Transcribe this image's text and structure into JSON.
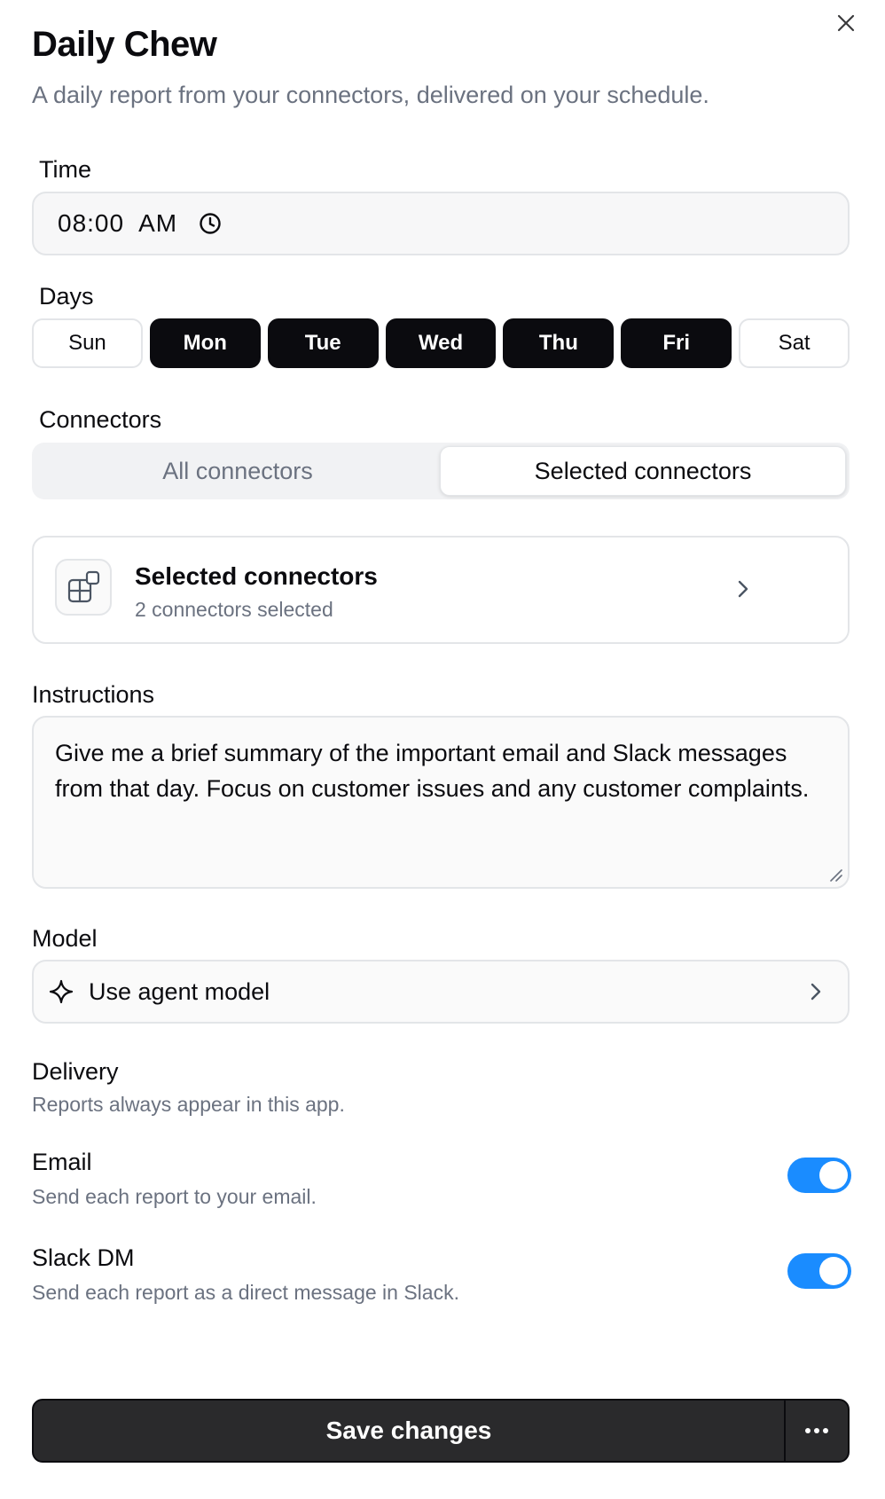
{
  "header": {
    "title": "Daily Chew",
    "subtitle": "A daily report from your connectors, delivered on your schedule."
  },
  "time": {
    "label": "Time",
    "value": "08:00  AM"
  },
  "days": {
    "label": "Days",
    "items": [
      {
        "label": "Sun",
        "active": false
      },
      {
        "label": "Mon",
        "active": true
      },
      {
        "label": "Tue",
        "active": true
      },
      {
        "label": "Wed",
        "active": true
      },
      {
        "label": "Thu",
        "active": true
      },
      {
        "label": "Fri",
        "active": true
      },
      {
        "label": "Sat",
        "active": false
      }
    ]
  },
  "connectors": {
    "label": "Connectors",
    "tabs": [
      {
        "label": "All connectors",
        "active": false
      },
      {
        "label": "Selected connectors",
        "active": true
      }
    ],
    "card_title": "Selected connectors",
    "card_subtitle": "2 connectors selected"
  },
  "instructions": {
    "label": "Instructions",
    "value": "Give me a brief summary of the important email and Slack messages from that day. Focus on customer issues and any customer complaints."
  },
  "model": {
    "label": "Model",
    "value": "Use agent model"
  },
  "delivery": {
    "label": "Delivery",
    "note": "Reports always appear in this app.",
    "email_label": "Email",
    "email_desc": "Send each report to your email.",
    "email_on": true,
    "slack_label": "Slack DM",
    "slack_desc": "Send each report as a direct message in Slack.",
    "slack_on": true
  },
  "footer": {
    "save_label": "Save changes"
  },
  "colors": {
    "accent": "#1a8cff",
    "selected_day": "#0b0b0f",
    "save_button": "#2a2a2c"
  },
  "icons": [
    "close-icon",
    "clock-icon",
    "connectors-icon",
    "chevron-right-icon",
    "sparkle-icon",
    "more-icon",
    "resize-handle-icon"
  ]
}
